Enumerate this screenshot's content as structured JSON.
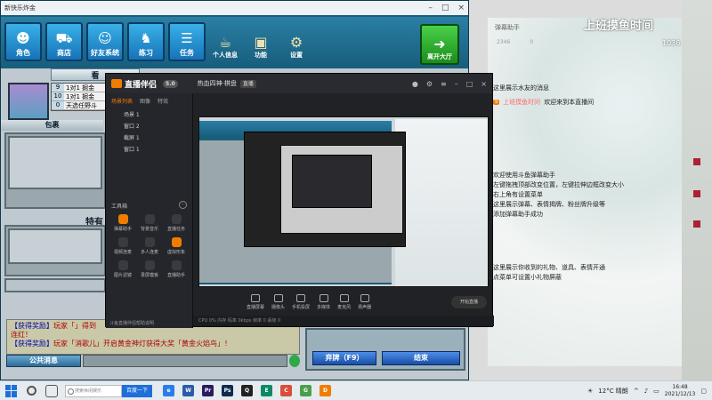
{
  "game": {
    "title": "新快乐炸金",
    "toolbar": [
      {
        "label": "角色",
        "icon": "user-icon"
      },
      {
        "label": "商店",
        "icon": "cart-icon"
      },
      {
        "label": "好友系统",
        "icon": "friends-icon"
      },
      {
        "label": "练习",
        "icon": "practice-icon"
      },
      {
        "label": "任务",
        "icon": "task-icon"
      }
    ],
    "mini_tools": [
      {
        "label": "个人信息",
        "icon": "coffee-icon"
      },
      {
        "label": "功能",
        "icon": "box-icon"
      },
      {
        "label": "设置",
        "icon": "gear-icon"
      }
    ],
    "enter_label": "离开大厅",
    "tab_label": "看",
    "rank_rows": [
      {
        "no": "9",
        "text": "1对1 掘金"
      },
      {
        "no": "10",
        "text": "1对1 掘金"
      },
      {
        "no": "0",
        "text": "天选任野斗"
      }
    ],
    "package_label": "包裹",
    "section_label": "特有",
    "chat_lines": [
      {
        "prefix": "【获得奖励】",
        "text": "玩家「」得到"
      },
      {
        "prefix": "",
        "text": "连红！"
      },
      {
        "prefix": "【获得奖励】",
        "text": "玩家「消歌儿」开启黄金神灯获得大奖「黄金火焰鸟」！"
      }
    ],
    "public_msg": "公共消息",
    "fold_label": "弃牌（F9）",
    "end_label": "结束"
  },
  "stream": {
    "app_name": "直播伴侣",
    "badge": "5.0",
    "room_title": "热血四神·棋盘",
    "room_tag": "直播",
    "sidebar_tabs": [
      "场景列表",
      "图像",
      "特效"
    ],
    "scenes": [
      "场景 1",
      "窗口 2",
      "截屏 1",
      "窗口 1"
    ],
    "tools_title": "工具箱",
    "tools": [
      {
        "label": "弹幕助手",
        "hot": true
      },
      {
        "label": "背景音乐",
        "hot": false
      },
      {
        "label": "直播任务",
        "hot": false
      },
      {
        "label": "视频连麦",
        "hot": false
      },
      {
        "label": "多人连麦",
        "hot": false
      },
      {
        "label": "虚拟形象",
        "hot": true
      },
      {
        "label": "图片滤镜",
        "hot": false
      },
      {
        "label": "录屏模板",
        "hot": false
      },
      {
        "label": "直播助手",
        "hot": false
      }
    ],
    "bottom_link": "斗鱼直播伴侣帮助说明",
    "controls": [
      "直播屏幕",
      "摄像头",
      "手机投屏",
      "多媒体",
      "麦克风",
      "扬声器"
    ],
    "start_label": "开始直播",
    "status": "CPU 0%  内存  码率 0kbps  帧率 0  丢帧 0"
  },
  "assistant": {
    "title": "弹幕助手",
    "stats": [
      "2346",
      "0"
    ],
    "notice_title": "这里展示水友的消息",
    "welcome_badge": "9",
    "welcome_name": "上班摸鱼时间",
    "welcome_text": "欢迎来到本直播间",
    "guide_lines": [
      "欢迎使用斗鱼弹幕助手",
      "左键拖拽顶部改变位置，左键拉伸边框改变大小",
      "右上角有设置菜单",
      "这里展示弹幕、表情揭牌、粉丝牌升级等",
      "添加弹幕助手成功"
    ],
    "gift_lines": [
      "这里展示你收到的礼物、道具、表情开通",
      "点菜单可设置小礼物屏蔽"
    ]
  },
  "watermark": {
    "title": "上班摸鱼时间",
    "sub": "1036"
  },
  "taskbar": {
    "search_placeholder": "搜索休闲娱乐",
    "search_button": "百度一下",
    "apps": [
      {
        "label": "e",
        "color": "#2b7de9"
      },
      {
        "label": "W",
        "color": "#2a5caa"
      },
      {
        "label": "Pr",
        "color": "#2a1a5e"
      },
      {
        "label": "Ps",
        "color": "#0d2c4f"
      },
      {
        "label": "Q",
        "color": "#222222"
      },
      {
        "label": "E",
        "color": "#0b8a6a"
      },
      {
        "label": "C",
        "color": "#d94e3a"
      },
      {
        "label": "G",
        "color": "#4aa04a"
      },
      {
        "label": "D",
        "color": "#f07d00"
      }
    ],
    "weather": "12°C 晴朗",
    "time": "16:48",
    "date": "2021/12/13"
  }
}
